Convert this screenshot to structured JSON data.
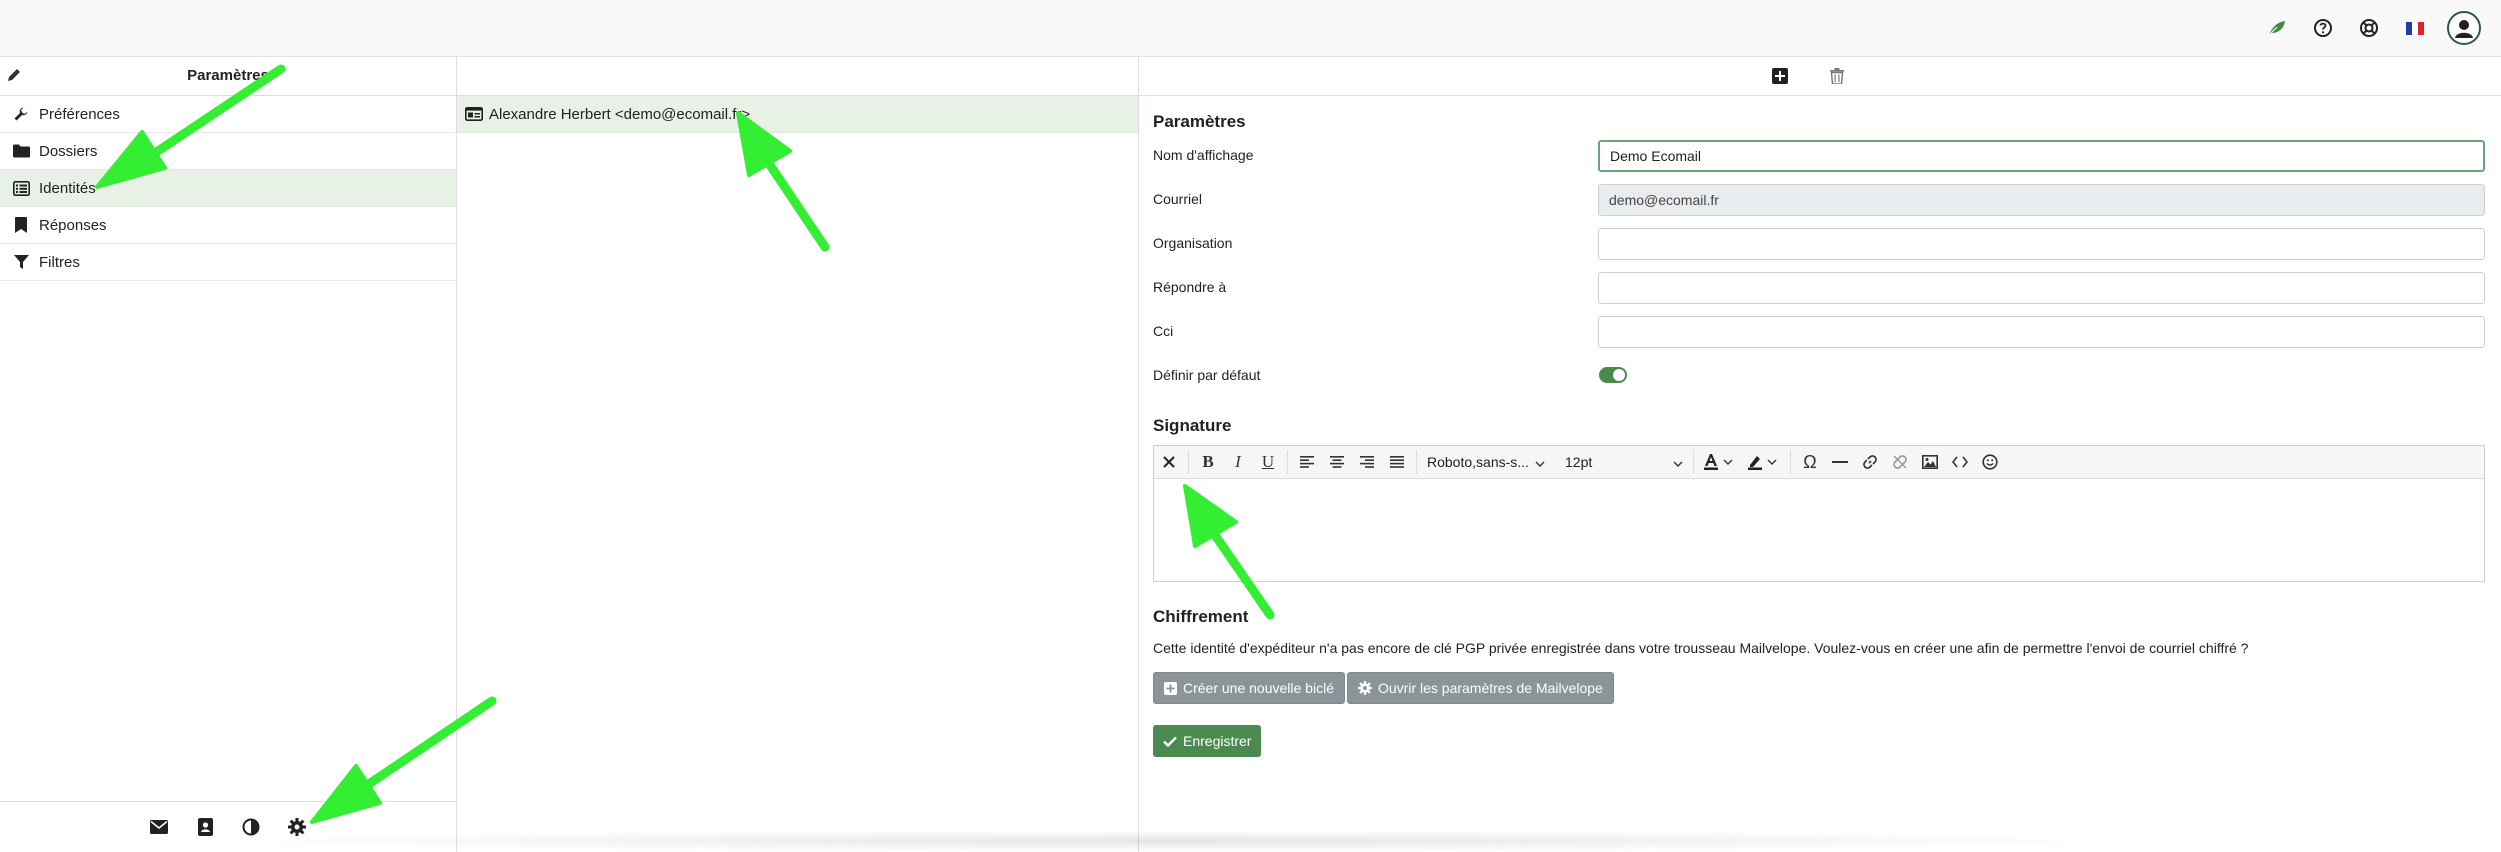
{
  "header": {
    "icons": [
      "leaf-icon",
      "help-icon",
      "support-icon",
      "french-flag-icon",
      "user-avatar-icon"
    ]
  },
  "sidebar": {
    "title": "Paramètres",
    "items": [
      {
        "label": "Préférences",
        "icon": "wrench-icon"
      },
      {
        "label": "Dossiers",
        "icon": "folder-icon"
      },
      {
        "label": "Identités",
        "icon": "identity-list-icon",
        "active": true
      },
      {
        "label": "Réponses",
        "icon": "bookmark-icon"
      },
      {
        "label": "Filtres",
        "icon": "filter-icon"
      }
    ],
    "footer_icons": [
      "mail-icon",
      "contacts-icon",
      "theme-icon",
      "settings-gear-icon"
    ]
  },
  "identities": {
    "items": [
      {
        "label": "Alexandre Herbert <demo@ecomail.fr>"
      }
    ]
  },
  "form": {
    "toolbar_icons": [
      "add-icon",
      "trash-icon"
    ],
    "section_title": "Paramètres",
    "fields": {
      "display_name": {
        "label": "Nom d'affichage",
        "value": "Demo Ecomail"
      },
      "email": {
        "label": "Courriel",
        "value": "demo@ecomail.fr"
      },
      "organization": {
        "label": "Organisation",
        "value": ""
      },
      "reply_to": {
        "label": "Répondre à",
        "value": ""
      },
      "bcc": {
        "label": "Cci",
        "value": ""
      },
      "default": {
        "label": "Définir par défaut",
        "value": true
      }
    },
    "signature": {
      "title": "Signature",
      "font": "Roboto,sans-s...",
      "size": "12pt"
    },
    "encryption": {
      "title": "Chiffrement",
      "text": "Cette identité d'expéditeur n'a pas encore de clé PGP privée enregistrée dans votre trousseau Mailvelope. Voulez-vous en créer une afin de permettre l'envoi de courriel chiffré ?",
      "create_key_label": "Créer une nouvelle biclé",
      "open_settings_label": "Ouvrir les paramètres de Mailvelope"
    },
    "save_label": "Enregistrer"
  },
  "colors": {
    "active_bg": "#e7f1e6",
    "accent_green": "#4b8b4f",
    "annotation_arrow": "#33ee33"
  }
}
